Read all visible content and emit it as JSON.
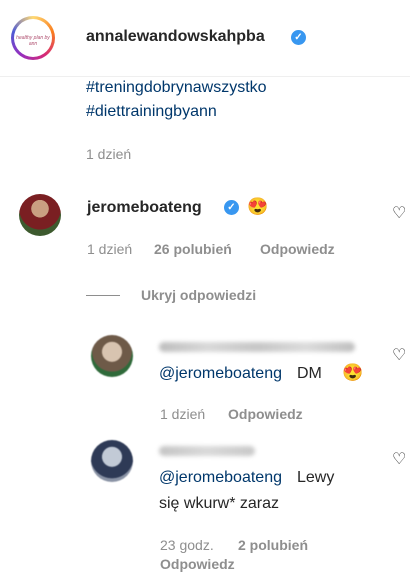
{
  "post": {
    "owner_username": "annalewandowskahpba",
    "owner_avatar_text": "healthy plan by ann",
    "caption_hashtags": [
      "#treningdobrynawszystko",
      "#diettrainingbyann"
    ],
    "caption_time": "1 dzień",
    "menu_icon": "more-icon"
  },
  "comment": {
    "username": "jeromeboateng",
    "emoji": "😍",
    "time": "1 dzień",
    "likes": "26 polubień",
    "reply_label": "Odpowiedz",
    "heart_icon": "heart-outline-icon"
  },
  "replies_toggle": {
    "label": "Ukryj odpowiedzi"
  },
  "replies": [
    {
      "mention": "@jeromeboateng",
      "text": "DM",
      "emoji": "😍",
      "time": "1 dzień",
      "reply_label": "Odpowiedz"
    },
    {
      "mention": "@jeromeboateng",
      "text": "Lewy",
      "text_line2": "się wkurw* zaraz",
      "time": "23 godz.",
      "likes": "2 polubień",
      "reply_label": "Odpowiedz"
    }
  ],
  "colors": {
    "verified": "#3897f0",
    "link": "#00376b",
    "secondary_text": "#8e8e8e",
    "primary_text": "#262626"
  }
}
